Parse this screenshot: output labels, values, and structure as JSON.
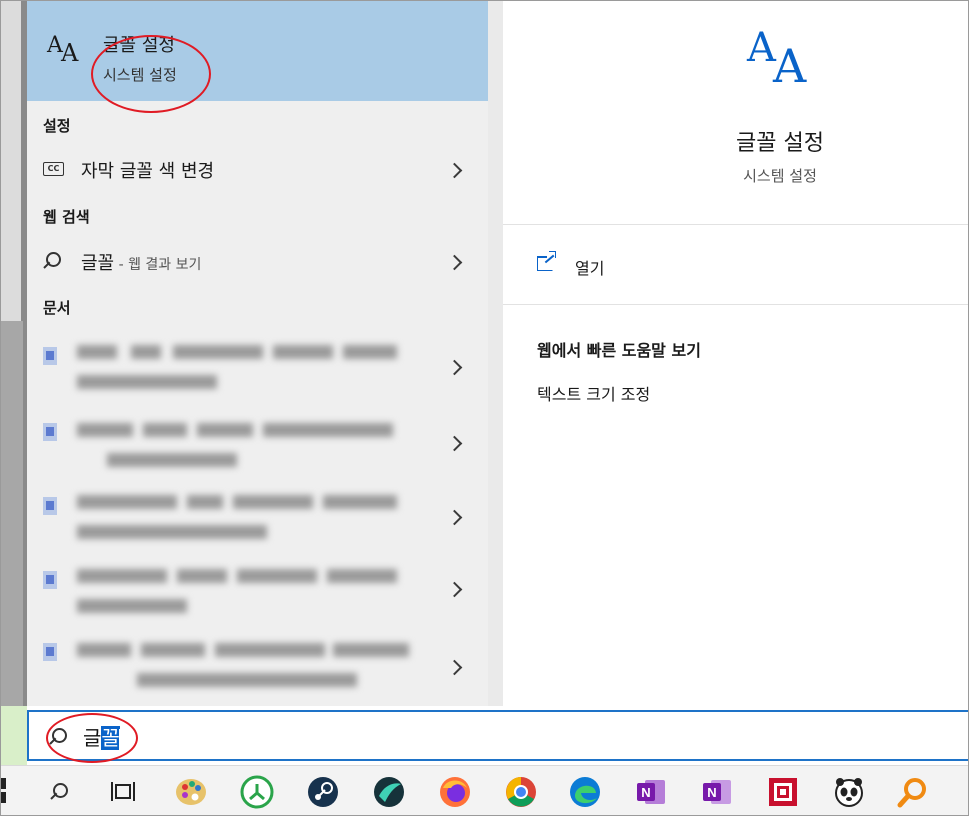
{
  "top_result": {
    "title": "글꼴 설정",
    "subtitle": "시스템 설정",
    "icon": "font-aa-icon"
  },
  "sections": {
    "settings": "설정",
    "web_search": "웹 검색",
    "documents": "문서"
  },
  "settings_items": [
    {
      "label": "자막 글꼴 색 변경",
      "icon": "closed-caption-icon"
    }
  ],
  "web_items": [
    {
      "label": "글꼴",
      "suffix": " - 웹 결과 보기",
      "icon": "search-icon"
    }
  ],
  "preview": {
    "title": "글꼴 설정",
    "subtitle": "시스템 설정",
    "open_label": "열기",
    "help_heading": "웹에서 빠른 도움말 보기",
    "help_links": [
      "텍스트 크기 조정"
    ]
  },
  "search": {
    "typed": "글",
    "selected": "꼴"
  },
  "colors": {
    "accent": "#0a63c9",
    "selected_result": "#a9cbe6",
    "annotation": "#e01b24"
  },
  "taskbar_icons": [
    "start-icon",
    "search-icon",
    "task-view-icon",
    "paint-palette-icon",
    "green-app-icon",
    "steam-icon",
    "teal-app-icon",
    "firefox-icon",
    "chrome-icon",
    "edge-icon",
    "onenote-icon",
    "onenote-alt-icon",
    "red-app-icon",
    "panda-app-icon",
    "magnifier-app-icon"
  ]
}
